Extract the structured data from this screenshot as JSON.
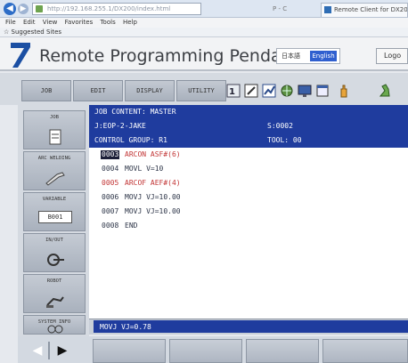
{
  "browser": {
    "address": "http://192.168.255.1/DX200/index.html",
    "address_right": "P - C",
    "tab_title": "Remote Client for DX200",
    "menu": [
      "File",
      "Edit",
      "View",
      "Favorites",
      "Tools",
      "Help"
    ],
    "favorites": "Suggested Sites"
  },
  "app": {
    "title": "Remote Programming Pendant",
    "lang_jp": "日本語",
    "lang_en": "English",
    "logout": "Logo"
  },
  "top_menu": [
    "JOB",
    "EDIT",
    "DISPLAY",
    "UTILITY"
  ],
  "left_menu": [
    {
      "label": "JOB",
      "icon": "job-icon"
    },
    {
      "label": "ARC WELDING",
      "icon": "torch-icon"
    },
    {
      "label": "VARIABLE",
      "icon": "variable-icon",
      "value": "B001"
    },
    {
      "label": "IN/OUT",
      "icon": "io-icon"
    },
    {
      "label": "ROBOT",
      "icon": "robot-icon"
    },
    {
      "label": "SYSTEM INFO",
      "icon": "system-info-icon"
    }
  ],
  "job": {
    "content": "JOB CONTENT: MASTER",
    "name": "J:EOP-2-JAKE",
    "step": "S:0002",
    "group": "CONTROL GROUP: R1",
    "tool": "TOOL: 00",
    "lines": [
      {
        "no": "0003",
        "text": "ARCON ASF#(6)",
        "color": "red",
        "selected": true
      },
      {
        "no": "0004",
        "text": "MOVL V=10",
        "color": "normal"
      },
      {
        "no": "0005",
        "text": "ARCOF AEF#(4)",
        "color": "red"
      },
      {
        "no": "0006",
        "text": "MOVJ VJ=10.00",
        "color": "normal"
      },
      {
        "no": "0007",
        "text": "MOVJ VJ=10.00",
        "color": "normal"
      },
      {
        "no": "0008",
        "text": "END",
        "color": "normal"
      }
    ]
  },
  "status_input": "MOVJ VJ=0.78",
  "colors": {
    "header_blue": "#1f3c9e",
    "inst_red": "#c23535"
  }
}
